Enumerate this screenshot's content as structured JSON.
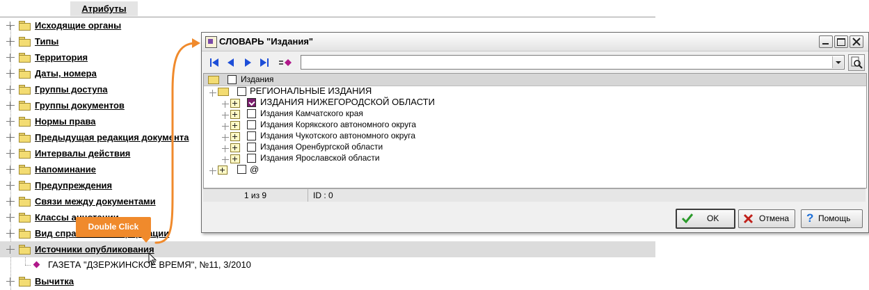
{
  "tab": {
    "label": "Атрибуты"
  },
  "attributes": {
    "items": [
      "Исходящие органы",
      "Типы",
      "Территория",
      "Даты, номера",
      "Группы доступа",
      "Группы документов",
      "Нормы права",
      "Предыдущая редакция документа",
      "Интервалы действия",
      "Напоминание",
      "Предупреждения",
      "Связи между документами",
      "Классы аннотации",
      "Вид справочной информации",
      "Источники опубликования",
      "Вычитка"
    ],
    "selected_item": "Источники опубликования",
    "child_item": "ГАЗЕТА \"ДЗЕРЖИНСКОЕ ВРЕМЯ\", №11, 3/2010"
  },
  "callout": {
    "text": "Double Click"
  },
  "dialog": {
    "title": "СЛОВАРЬ \"Издания\"",
    "filter_value": "",
    "tree": {
      "root": "Издания",
      "group": "РЕГИОНАЛЬНЫЕ ИЗДАНИЯ",
      "items": [
        "ИЗДАНИЯ НИЖЕГОРОДСКОЙ ОБЛАСТИ",
        "Издания Камчатского края",
        "Издания Корякского автономного округа",
        "Издания Чукотского автономного округа",
        "Издания Оренбургской области",
        "Издания Ярославской области"
      ],
      "other": "@"
    },
    "status": {
      "position": "1 из 9",
      "id": "ID : 0"
    },
    "buttons": {
      "ok": "OK",
      "cancel": "Отмена",
      "help": "Помощь"
    }
  },
  "colors": {
    "accent": "#f08a2c",
    "checked": "#7a1c6c",
    "selected_row": "#dcdcdc"
  }
}
